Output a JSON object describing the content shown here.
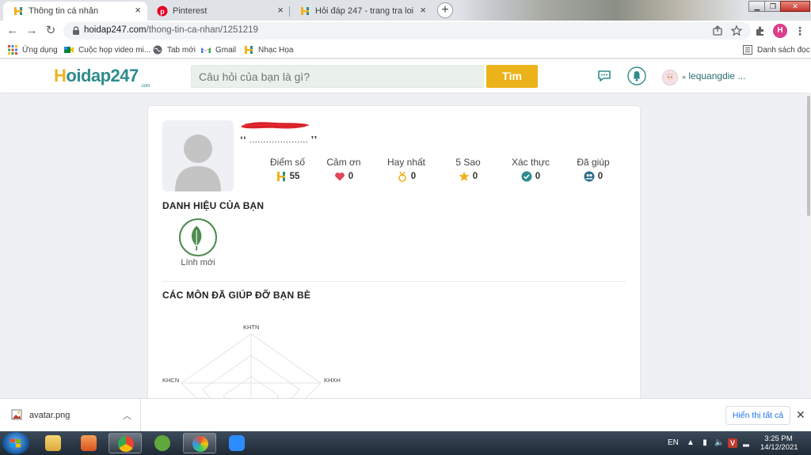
{
  "browser": {
    "tabs": [
      {
        "title": "Thông tin cá nhân",
        "active": true,
        "favicon": "hoidap-favicon"
      },
      {
        "title": "Pinterest",
        "active": false,
        "favicon": "pinterest-favicon"
      },
      {
        "title": "Hỏi đáp 247 - trang tra loi",
        "active": false,
        "favicon": "hoidap-favicon"
      }
    ],
    "new_tab_glyph": "+",
    "close_glyph": "×",
    "url_host": "hoidap247.com",
    "url_path": "/thong-tin-ca-nhan/1251219",
    "profile_initial": "H",
    "bookmarks": [
      {
        "label": "Ứng dụng",
        "icon": "apps-grid-icon"
      },
      {
        "label": "Cuộc họp video mi...",
        "icon": "google-meet-icon"
      },
      {
        "label": "Tab mới",
        "icon": "globe-icon"
      },
      {
        "label": "Gmail",
        "icon": "gmail-icon"
      },
      {
        "label": "Nhạc Họa",
        "icon": "hoidap-favicon"
      }
    ],
    "reading_list": "Danh sách đọc"
  },
  "site": {
    "logo_h": "H",
    "logo_rest": "oidap247",
    "logo_suffix": ".com",
    "search_placeholder": "Câu hỏi của bạn là gì?",
    "search_button": "Tìm",
    "username": "lequangdie ..."
  },
  "profile": {
    "quote": "❛❛ ..................... ❜❜",
    "stats": [
      {
        "label": "Điểm số",
        "value": "55",
        "icon": "points-h-icon",
        "color": "#f0b21d"
      },
      {
        "label": "Cảm ơn",
        "value": "0",
        "icon": "heart-icon",
        "color": "#e0475b"
      },
      {
        "label": "Hay nhất",
        "value": "0",
        "icon": "medal-icon",
        "color": "#f0b21d"
      },
      {
        "label": "5 Sao",
        "value": "0",
        "icon": "star-icon",
        "color": "#f0b21d"
      },
      {
        "label": "Xác thực",
        "value": "0",
        "icon": "verified-check-icon",
        "color": "#2e8c8c"
      },
      {
        "label": "Đã giúp",
        "value": "0",
        "icon": "helped-users-icon",
        "color": "#2e8c8c"
      }
    ],
    "titles_heading": "DANH HIỆU CỦA BẠN",
    "badge_label": "Lính mới",
    "subjects_heading": "CÁC MÔN ĐÃ GIÚP ĐỠ BẠN BÈ",
    "radar_labels": {
      "top": "KHTN",
      "left": "KHCN",
      "right": "KHXH"
    }
  },
  "downloads": {
    "file_name": "avatar.png",
    "show_all": "Hiển thị tất cả"
  },
  "taskbar": {
    "language": "EN",
    "time": "3:25 PM",
    "date": "14/12/2021"
  },
  "colors": {
    "brand_yellow": "#ecb21a",
    "brand_teal": "#2e8c8c",
    "leaf_green": "#4f8a4f"
  }
}
